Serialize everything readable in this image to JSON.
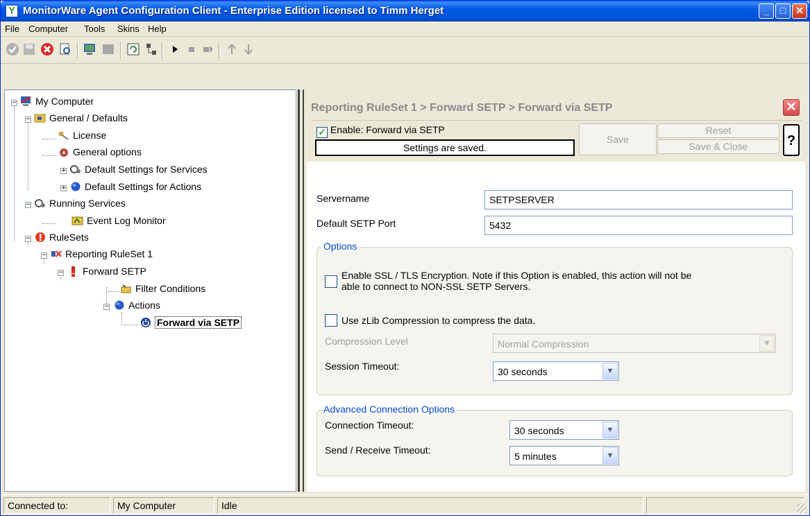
{
  "window": {
    "title": "MonitorWare Agent Configuration Client - Enterprise Edition licensed to Timm Herget",
    "min_glyph": "_",
    "max_glyph": "□",
    "close_glyph": "✕"
  },
  "menu": {
    "file": "File",
    "computer": "Computer",
    "tools": "Tools",
    "skins": "Skins",
    "help": "Help"
  },
  "toolbar": {
    "icons": [
      "check-icon",
      "save-icon",
      "stop-icon",
      "search-icon",
      "computer-icon",
      "panel-icon",
      "refresh-icon",
      "network-icon",
      "play-icon",
      "stop-square-icon",
      "step-icon",
      "up-arrow-icon",
      "down-arrow-icon"
    ]
  },
  "tree": {
    "my_computer": "My Computer",
    "general_defaults": "General / Defaults",
    "license": "License",
    "general_options": "General options",
    "default_services": "Default Settings for Services",
    "default_actions": "Default Settings for Actions",
    "running_services": "Running Services",
    "event_log_monitor": "Event Log Monitor",
    "rulesets": "RuleSets",
    "reporting_ruleset": "Reporting RuleSet 1",
    "forward_setp": "Forward SETP",
    "filter_conditions": "Filter Conditions",
    "actions": "Actions",
    "forward_via_setp": "Forward via SETP",
    "expander_minus": "−",
    "expander_plus": "+"
  },
  "panel": {
    "breadcrumb": "Reporting RuleSet 1 > Forward SETP > Forward via SETP",
    "close_glyph": "✕",
    "enable_label": "Enable: Forward via SETP",
    "enable_checked": true,
    "check_glyph": "✓",
    "status": "Settings are saved.",
    "save": "Save",
    "reset": "Reset",
    "save_close": "Save & Close",
    "help": "?"
  },
  "form": {
    "servername_label": "Servername",
    "servername_value": "SETPSERVER",
    "port_label": "Default SETP Port",
    "port_value": "5432"
  },
  "options": {
    "legend": "Options",
    "ssl_label_line1": "Enable SSL / TLS Encryption. Note if this Option is enabled, this action will not be",
    "ssl_label_line2": "able to connect to NON-SSL SETP Servers.",
    "ssl_checked": false,
    "zlib_label": "Use zLib Compression to compress the data.",
    "zlib_checked": false,
    "compression_label": "Compression Level",
    "compression_value": "Normal Compression",
    "session_timeout_label": "Session Timeout:",
    "session_timeout_value": "30 seconds",
    "combo_arrow": "▼"
  },
  "advanced": {
    "legend": "Advanced Connection Options",
    "connection_timeout_label": "Connection Timeout:",
    "connection_timeout_value": "30 seconds",
    "send_receive_label": "Send / Receive Timeout:",
    "send_receive_value": "5 minutes"
  },
  "statusbar": {
    "connected_label": "Connected to:",
    "computer": "My Computer",
    "state": "Idle"
  }
}
